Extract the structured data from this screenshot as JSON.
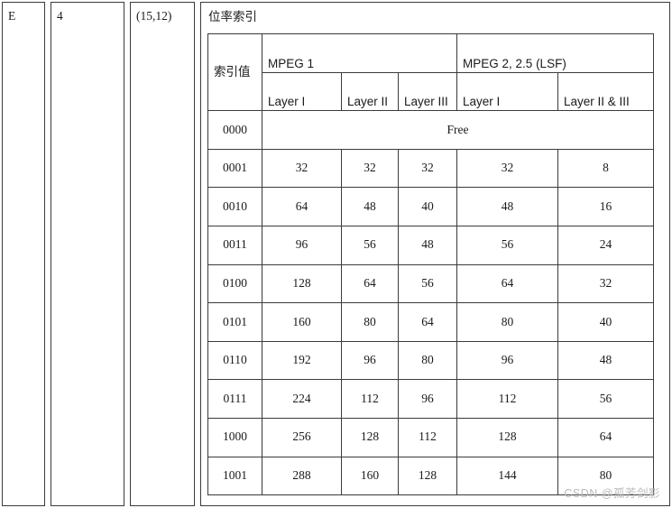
{
  "outer_row": {
    "cells": [
      {
        "text": "E"
      },
      {
        "text": "4"
      },
      {
        "text": "(15,12)"
      }
    ]
  },
  "inner_table": {
    "title": "位率索引",
    "index_header": "索引值",
    "groups": [
      {
        "label": "MPEG 1",
        "span": 3
      },
      {
        "label": "MPEG 2, 2.5 (LSF)",
        "span": 2
      }
    ],
    "layer_headers": [
      "Layer I",
      "Layer II",
      "Layer III",
      "Layer I",
      "Layer II & III"
    ],
    "free_label": "Free",
    "rows": [
      {
        "index": "0000",
        "free": true,
        "values": []
      },
      {
        "index": "0001",
        "free": false,
        "values": [
          "32",
          "32",
          "32",
          "32",
          "8"
        ]
      },
      {
        "index": "0010",
        "free": false,
        "values": [
          "64",
          "48",
          "40",
          "48",
          "16"
        ]
      },
      {
        "index": "0011",
        "free": false,
        "values": [
          "96",
          "56",
          "48",
          "56",
          "24"
        ]
      },
      {
        "index": "0100",
        "free": false,
        "values": [
          "128",
          "64",
          "56",
          "64",
          "32"
        ]
      },
      {
        "index": "0101",
        "free": false,
        "values": [
          "160",
          "80",
          "64",
          "80",
          "40"
        ]
      },
      {
        "index": "0110",
        "free": false,
        "values": [
          "192",
          "96",
          "80",
          "96",
          "48"
        ]
      },
      {
        "index": "0111",
        "free": false,
        "values": [
          "224",
          "112",
          "96",
          "112",
          "56"
        ]
      },
      {
        "index": "1000",
        "free": false,
        "values": [
          "256",
          "128",
          "112",
          "128",
          "64"
        ]
      },
      {
        "index": "1001",
        "free": false,
        "values": [
          "288",
          "160",
          "128",
          "144",
          "80"
        ]
      }
    ]
  },
  "watermark": {
    "text": "CSDN @孤芳剑影"
  },
  "colors": {
    "border": "#3b3b3b",
    "text": "#1a1a1a",
    "background": "#ffffff",
    "watermark": "#b9b9b9"
  }
}
